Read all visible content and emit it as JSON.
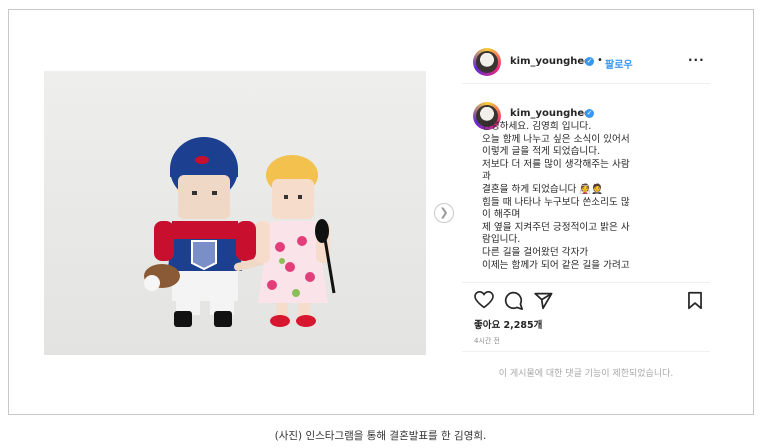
{
  "post": {
    "username": "kim_younghee",
    "follow_label": "팔로우",
    "caption_username": "kim_younghee",
    "caption_lines": [
      "안녕하세요. 김영희 입니다.",
      "오늘 함께 나누고 싶은 소식이 있어서",
      "이렇게 글을 적게 되었습니다.",
      "저보다 더 저를 많이 생각해주는 사람",
      "과",
      "결혼을 하게 되었습니다 👰🤵",
      "힘들 때 나타나 누구보다 쓴소리도 많",
      "이 해주며",
      "제 옆을 지켜주던 긍정적이고 밝은 사",
      "람입니다.",
      "다른 길을 걸어왔던 각자가",
      "이제는 함께가 되어 같은 길을 가려고"
    ],
    "likes": "좋아요 2,285개",
    "time": "4시간 전",
    "comments_notice": "이 게시물에 대한 댓글 기능이 제한되었습니다."
  },
  "icons": [
    "heart-icon",
    "comment-icon",
    "share-icon",
    "bookmark-icon",
    "more-icon",
    "verified-icon",
    "next-arrow-icon"
  ],
  "page_caption": "(사진) 인스타그램을 통해 결혼발표를 한 김영희."
}
